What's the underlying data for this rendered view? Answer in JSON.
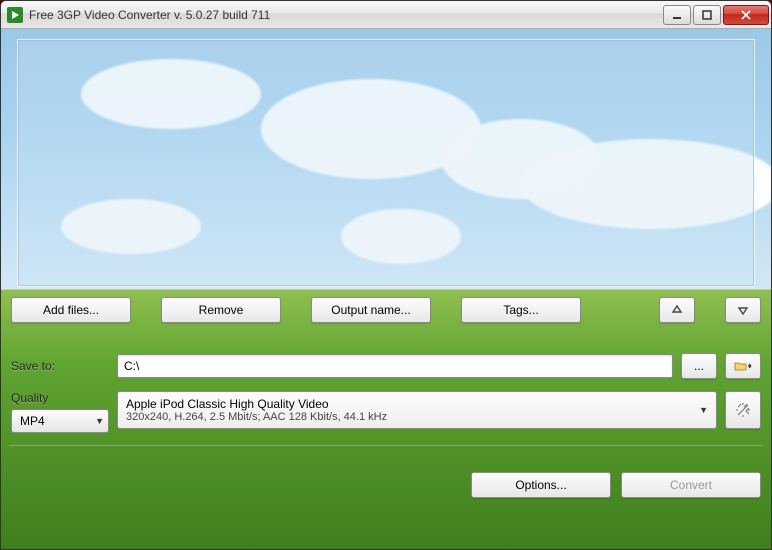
{
  "window": {
    "title": "Free 3GP Video Converter  v. 5.0.27 build 711"
  },
  "toolbar": {
    "add_files": "Add files...",
    "remove": "Remove",
    "output_name": "Output name...",
    "tags": "Tags..."
  },
  "save": {
    "label": "Save to:",
    "path": "C:\\",
    "browse": "..."
  },
  "quality": {
    "label": "Quality",
    "format": "MP4",
    "preset_name": "Apple iPod Classic High Quality Video",
    "preset_detail": "320x240, H.264, 2.5 Mbit/s; AAC 128 Kbit/s, 44.1 kHz"
  },
  "footer": {
    "options": "Options...",
    "convert": "Convert"
  }
}
